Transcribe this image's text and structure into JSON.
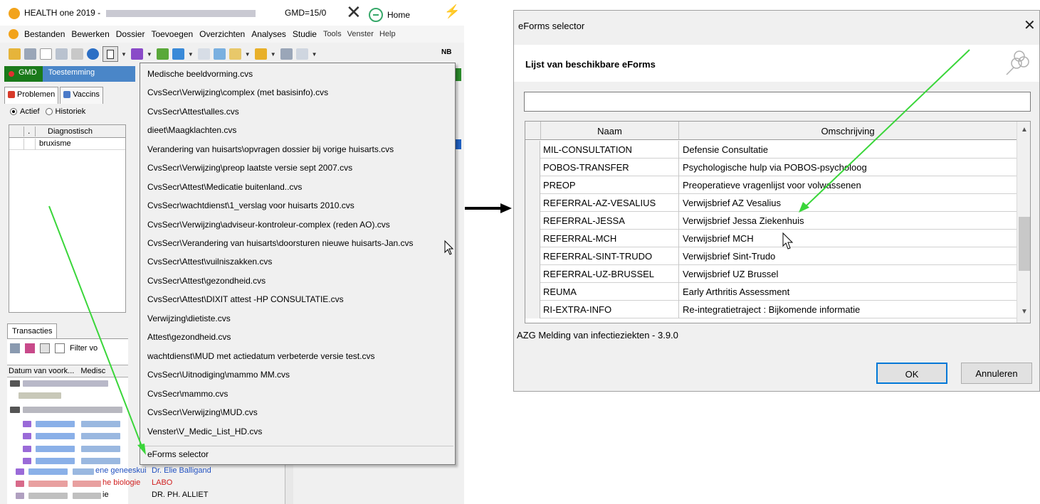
{
  "app": {
    "title": "HEALTH one 2019 -",
    "gmd_text": "GMD=15/0",
    "home_label": "Home",
    "menu": [
      "Bestanden",
      "Bewerken",
      "Dossier",
      "Toevoegen",
      "Overzichten",
      "Analyses",
      "Studie"
    ],
    "menu_cut": [
      "Tools",
      "Venster",
      "Help"
    ],
    "toolbar_nb": "NB",
    "gmd_button": "GMD",
    "toestemming_button": "Toestemming",
    "tabs": [
      "Problemen",
      "Vaccins"
    ],
    "radio_actief": "Actief",
    "radio_historiek": "Historiek",
    "grid_dot": ".",
    "grid_header": "Diagnostisch",
    "grid_value": "bruxisme",
    "transacties_tab": "Transacties",
    "filter_label": "Filter vo",
    "trans_header": "Datum van voork...",
    "trans_header2": "Medisc",
    "bottom": {
      "row1_spec": "ene geneeskui",
      "row1_doc": "Dr. Elie Balligand",
      "row2_spec": "he biologie",
      "row2_doc": "LABO",
      "row3_spec": "ie",
      "row3_doc": "DR. PH. ALLIET"
    }
  },
  "dropdown": {
    "items": [
      "Medische beeldvorming.cvs",
      "CvsSecr\\Verwijzing\\complex (met basisinfo).cvs",
      "CvsSecr\\Attest\\alles.cvs",
      "dieet\\Maagklachten.cvs",
      "Verandering van huisarts\\opvragen dossier bij vorige huisarts.cvs",
      "CvsSecr\\Verwijzing\\preop laatste versie sept 2007.cvs",
      "CvsSecr\\Attest\\Medicatie buitenland..cvs",
      "CvsSecr\\wachtdienst\\1_verslag voor huisarts 2010.cvs",
      "CvsSecr\\Verwijzing\\adviseur-kontroleur-complex (reden AO).cvs",
      "CvsSecr\\Verandering van huisarts\\doorsturen nieuwe huisarts-Jan.cvs",
      "CvsSecr\\Attest\\vuilniszakken.cvs",
      "CvsSecr\\Attest\\gezondheid.cvs",
      "CvsSecr\\Attest\\DIXIT attest -HP CONSULTATIE.cvs",
      "Verwijzing\\dietiste.cvs",
      "Attest\\gezondheid.cvs",
      "wachtdienst\\MUD met actiedatum  verbeterde versie test.cvs",
      "CvsSecr\\Uitnodiging\\mammo MM.cvs",
      "CvsSecr\\mammo.cvs",
      "CvsSecr\\Verwijzing\\MUD.cvs",
      "Venster\\V_Medic_List_HD.cvs"
    ],
    "eforms_item": "eForms selector"
  },
  "dialog": {
    "title": "eForms selector",
    "close_symbol": "✕",
    "subtitle": "Lijst van beschikbare eForms",
    "search_value": "",
    "columns": [
      "Naam",
      "Omschrijving"
    ],
    "rows": [
      {
        "name": "MIL-CONSULTATION",
        "desc": "Defensie Consultatie"
      },
      {
        "name": "POBOS-TRANSFER",
        "desc": "Psychologische hulp via POBOS-psycholoog"
      },
      {
        "name": "PREOP",
        "desc": "Preoperatieve vragenlijst voor volwassenen"
      },
      {
        "name": "REFERRAL-AZ-VESALIUS",
        "desc": "Verwijsbrief AZ Vesalius"
      },
      {
        "name": "REFERRAL-JESSA",
        "desc": "Verwijsbrief Jessa Ziekenhuis"
      },
      {
        "name": "REFERRAL-MCH",
        "desc": "Verwijsbrief MCH"
      },
      {
        "name": "REFERRAL-SINT-TRUDO",
        "desc": "Verwijsbrief Sint-Trudo"
      },
      {
        "name": "REFERRAL-UZ-BRUSSEL",
        "desc": "Verwijsbrief UZ Brussel"
      },
      {
        "name": "REUMA",
        "desc": "Early Arthritis Assessment"
      },
      {
        "name": "RI-EXTRA-INFO",
        "desc": "Re-integratietraject : Bijkomende informatie"
      }
    ],
    "status": "AZG Melding van infectieziekten - 3.9.0",
    "ok_label": "OK",
    "cancel_label": "Annuleren"
  },
  "colors": {
    "annotation_arrow": "#3ad63a",
    "accent": "#0078d7",
    "gmd_green": "#1a7a1a"
  }
}
